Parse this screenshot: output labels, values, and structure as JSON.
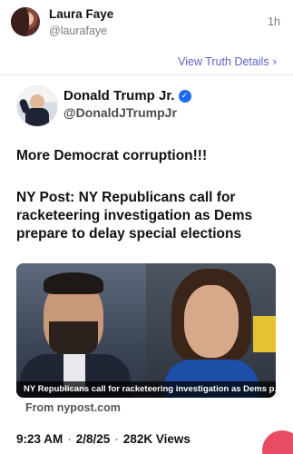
{
  "repost_header": {
    "display_name": "Laura Faye",
    "handle": "@laurafaye",
    "time": "1h"
  },
  "view_details_label": "View Truth Details",
  "quoted_post": {
    "author_name": "Donald Trump Jr.",
    "author_handle": "@DonaldJTrumpJr",
    "text_line_1": "More Democrat corruption!!!",
    "text_line_2": "NY Post: NY Republicans call for racketeering investigation as Dems prepare to delay special elections",
    "image_caption": "NY Republicans call for racketeering investigation as Dems p...",
    "source": "From nypost.com",
    "meta": {
      "time": "9:23 AM",
      "date": "2/8/25",
      "views": "282K Views"
    }
  },
  "colors": {
    "link": "#5a63c8",
    "verified": "#1d6bf3",
    "action_button": "#e94b62"
  }
}
